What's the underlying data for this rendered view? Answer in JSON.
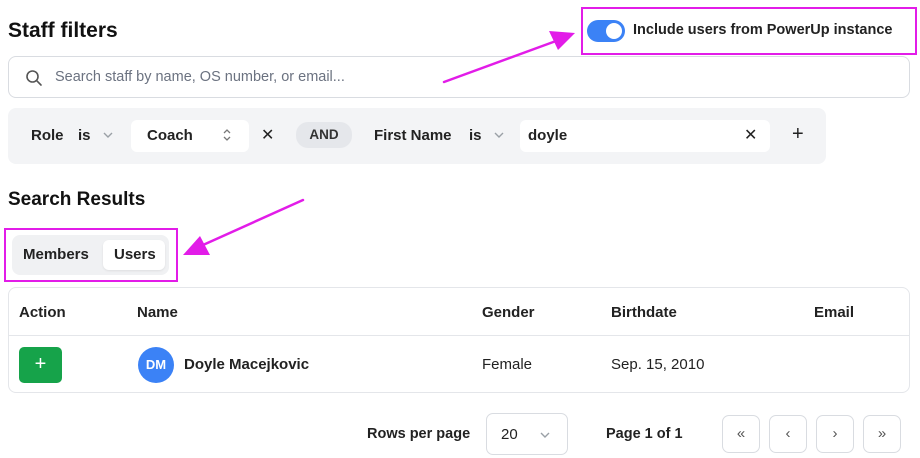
{
  "header": {
    "title": "Staff filters",
    "toggle_label": "Include users from PowerUp instance",
    "toggle_on": true
  },
  "search": {
    "placeholder": "Search staff by name, OS number, or email..."
  },
  "filters": {
    "rule1": {
      "field": "Role",
      "operator": "is",
      "value": "Coach"
    },
    "conjunction": "AND",
    "rule2": {
      "field": "First Name",
      "operator": "is",
      "value": "doyle"
    },
    "remove_symbol": "✕",
    "add_symbol": "+"
  },
  "results": {
    "title": "Search Results",
    "tabs": [
      {
        "label": "Members",
        "active": false
      },
      {
        "label": "Users",
        "active": true
      }
    ],
    "columns": [
      "Action",
      "Name",
      "Gender",
      "Birthdate",
      "Email"
    ],
    "rows": [
      {
        "action": "+",
        "initials": "DM",
        "name": "Doyle Macejkovic",
        "gender": "Female",
        "birthdate": "Sep. 15, 2010",
        "email": ""
      }
    ]
  },
  "pagination": {
    "rows_per_page_label": "Rows per page",
    "rows_per_page_value": "20",
    "page_info": "Page 1 of 1",
    "first": "«",
    "prev": "‹",
    "next": "›",
    "last": "»"
  },
  "colors": {
    "annotation": "#e21ce8",
    "accent": "#3b82f6",
    "add_button": "#16a34a"
  }
}
